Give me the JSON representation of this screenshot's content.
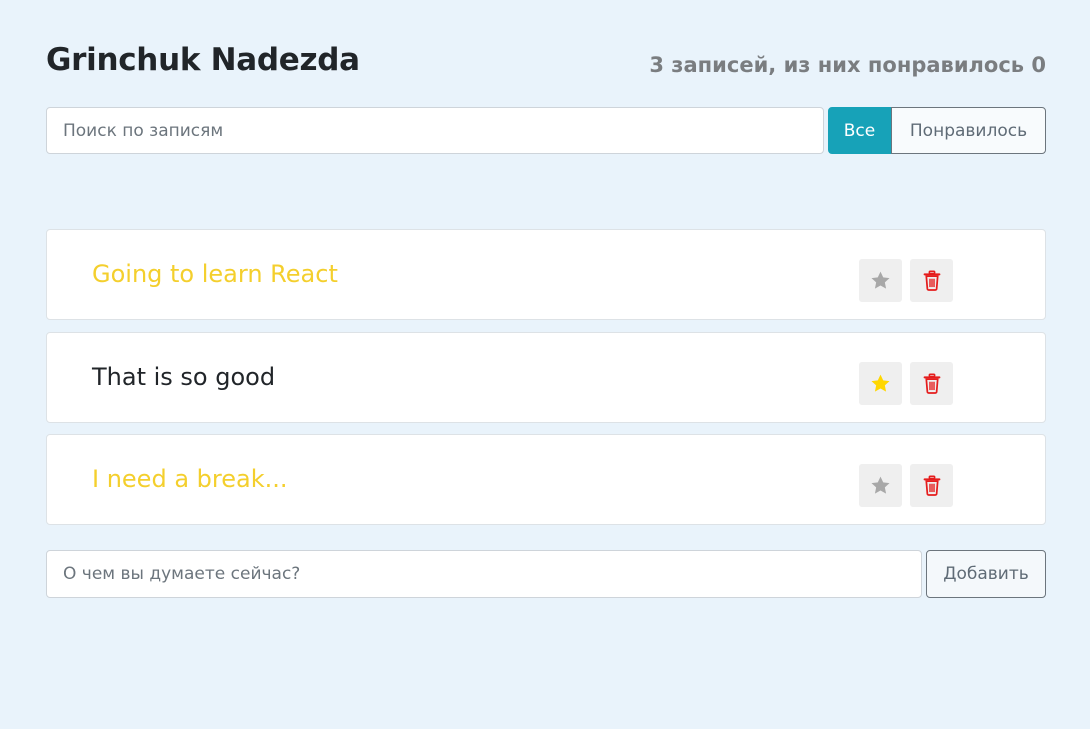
{
  "header": {
    "title": "Grinchuk Nadezda",
    "stats": "3 записей, из них понравилось 0"
  },
  "search": {
    "placeholder": "Поиск по записям",
    "value": ""
  },
  "filter": {
    "buttons": [
      {
        "label": "Все",
        "active": true
      },
      {
        "label": "Понравилось",
        "active": false
      }
    ]
  },
  "posts": [
    {
      "label": "Going to learn React",
      "important": true,
      "liked": false
    },
    {
      "label": "That is so good",
      "important": false,
      "liked": true
    },
    {
      "label": "I need a break...",
      "important": true,
      "liked": false
    }
  ],
  "add_form": {
    "placeholder": "О чем вы думаете сейчас?",
    "value": "",
    "button_label": "Добавить"
  },
  "icons": {
    "star": "star-icon",
    "trash": "trash-icon"
  },
  "colors": {
    "background": "#e9f3fb",
    "accent": "#17a2b8",
    "important_text": "#f4cf2d",
    "star_active": "#ffd700",
    "star_inactive": "#a8a8a8",
    "trash": "#e51d1d",
    "icon_button_bg": "#efefef"
  }
}
